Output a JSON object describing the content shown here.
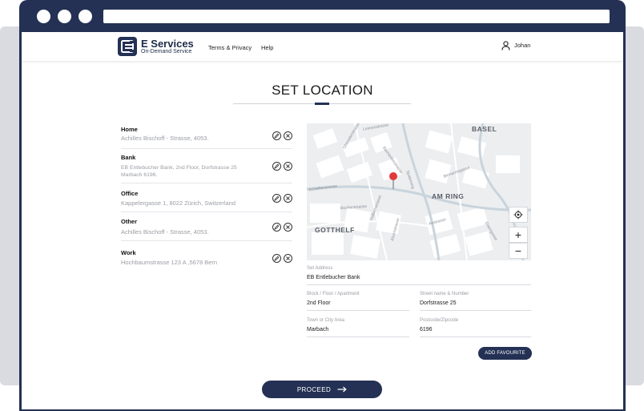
{
  "app": {
    "brand_name": "E Services",
    "brand_tagline": "On-Demand Service",
    "nav": [
      {
        "label": "Terms & Privacy"
      },
      {
        "label": "Help"
      }
    ],
    "user_name": "Johan"
  },
  "page": {
    "title": "SET LOCATION"
  },
  "saved_addresses": [
    {
      "name": "Home",
      "line1": "Achilles Bischoff - Strasse, 4053.",
      "line2": ""
    },
    {
      "name": "Bank",
      "line1": "EB Entlebucher Bank, 2nd Floor, Dorfstrasse 25",
      "line2": "Marbach 6196."
    },
    {
      "name": "Office",
      "line1": "Kappelergasse 1, 8022 Zürich, Switzerland",
      "line2": ""
    },
    {
      "name": "Other",
      "line1": "Achilles Bischoff - Strasse, 4053.",
      "line2": ""
    },
    {
      "name": "Work",
      "line1": "Hochbaumstrasse 123 A ,5678 Bern",
      "line2": ""
    }
  ],
  "map": {
    "district_labels": [
      "BASEL",
      "AM RING",
      "GOTTHELF"
    ],
    "street_labels": [
      "Spalenring",
      "Schwillerstrasse",
      "Buchenstrasse",
      "Birmannsgasse",
      "Austrasse",
      "Eisengasse",
      "Holbeinstrasse",
      "Leimenstrasse",
      "Bachlettenstrasse",
      "Oberwilerstrasse",
      "Ahornstrasse"
    ],
    "controls": {
      "zoom_in": "+",
      "zoom_out": "−"
    }
  },
  "form": {
    "set_address": {
      "label": "Set Address",
      "value": "EB Entlebucher Bank"
    },
    "block": {
      "label": "Block / Floor / Apartment",
      "value": "2nd Floor"
    },
    "street": {
      "label": "Street name & Number",
      "value": "Dorfstrasse 25"
    },
    "town": {
      "label": "Town or City Area",
      "value": "Marbach"
    },
    "postcode": {
      "label": "Postcode/Zipcode",
      "value": "6196"
    },
    "add_favourite_label": "ADD FAVOURITE"
  },
  "actions": {
    "proceed_label": "PROCEED"
  },
  "colors": {
    "primary": "#243155",
    "map_pin": "#e03a3a",
    "map_bg": "#eceef0"
  }
}
